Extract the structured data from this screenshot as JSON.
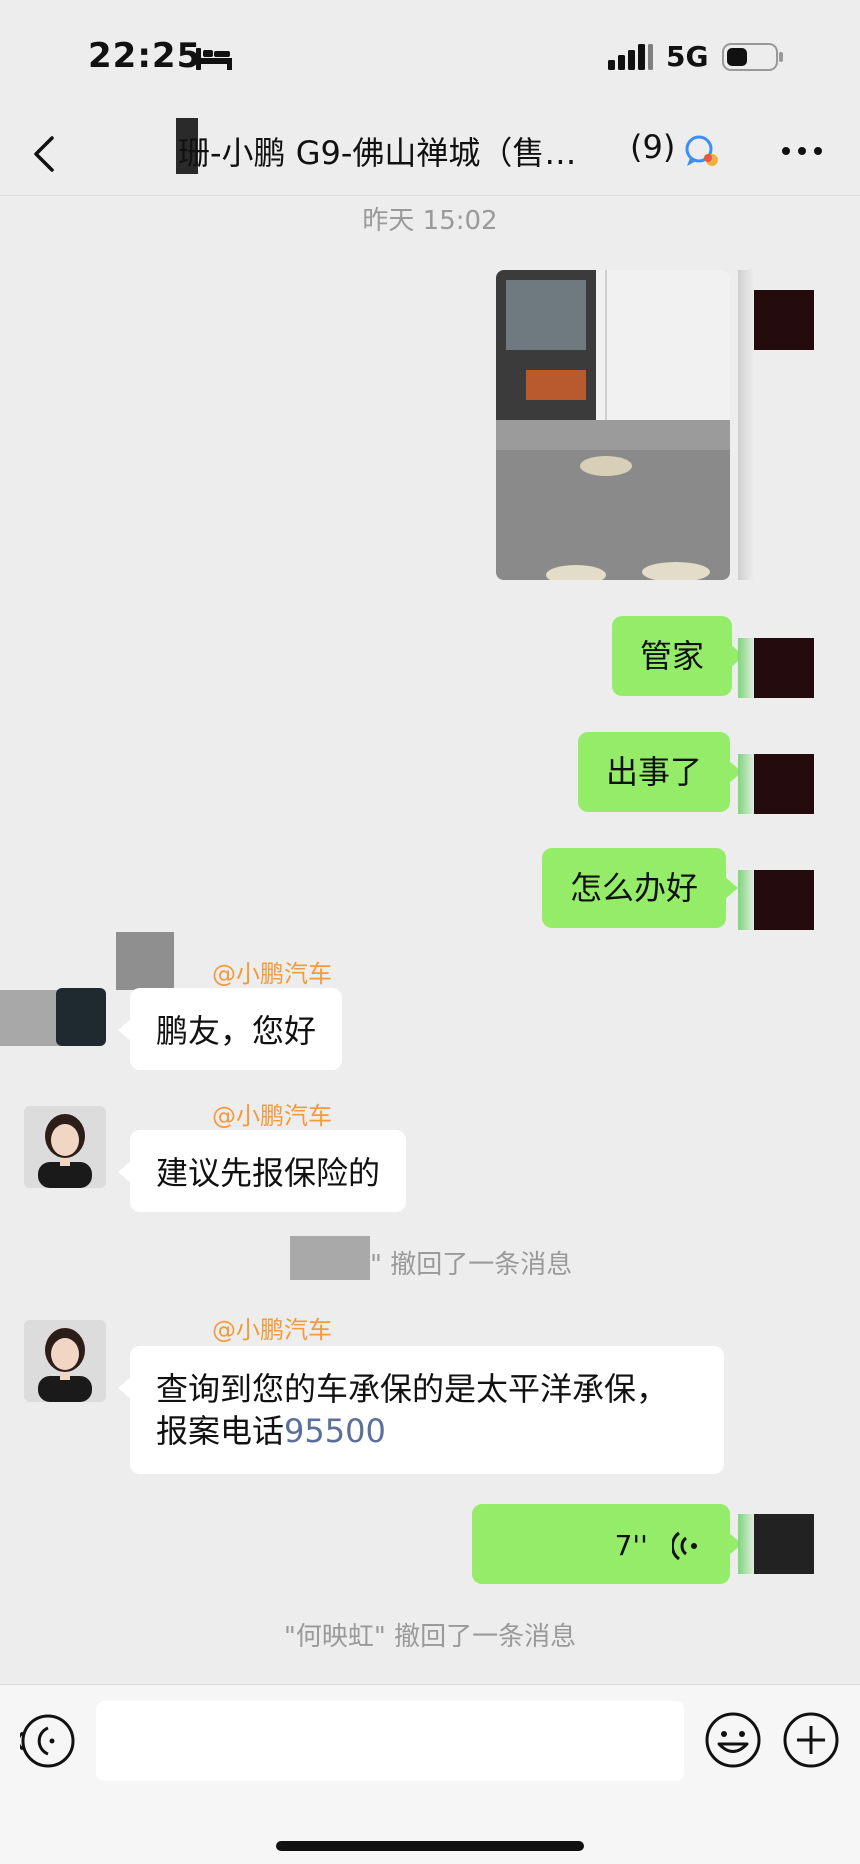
{
  "status_bar": {
    "time": "22:25",
    "network": "5G"
  },
  "nav": {
    "title": "珊-小鹏 G9-佛山禅城（售…",
    "member_count": "(9)"
  },
  "chat": {
    "timestamp": "昨天 15:02",
    "messages_out": {
      "m1": "管家",
      "m2": "出事了",
      "m3": "怎么办好",
      "voice_duration": "7''"
    },
    "msg_in_1": {
      "sender": "@小鹏汽车",
      "text": "鹏友，您好"
    },
    "msg_in_2": {
      "sender": "@小鹏汽车",
      "text": "建议先报保险的"
    },
    "recall_1": "\" 撤回了一条消息",
    "msg_in_3": {
      "sender": "@小鹏汽车",
      "line1": "查询到您的车承保的是太平洋承保，",
      "line2_prefix": "报案电话",
      "phone": "95500"
    },
    "recall_2": "\"何映虹\" 撤回了一条消息"
  },
  "colors": {
    "bubble_out": "#95ec69",
    "bubble_in": "#ffffff",
    "background": "#ededed",
    "sender_name": "#f29b3c",
    "link": "#5a6f9a"
  },
  "icons": {
    "back": "chevron-left-icon",
    "group": "group-chat-icon",
    "more": "more-dots-icon",
    "voice_input": "voice-input-icon",
    "emoji": "emoji-icon",
    "add": "plus-circle-icon"
  }
}
